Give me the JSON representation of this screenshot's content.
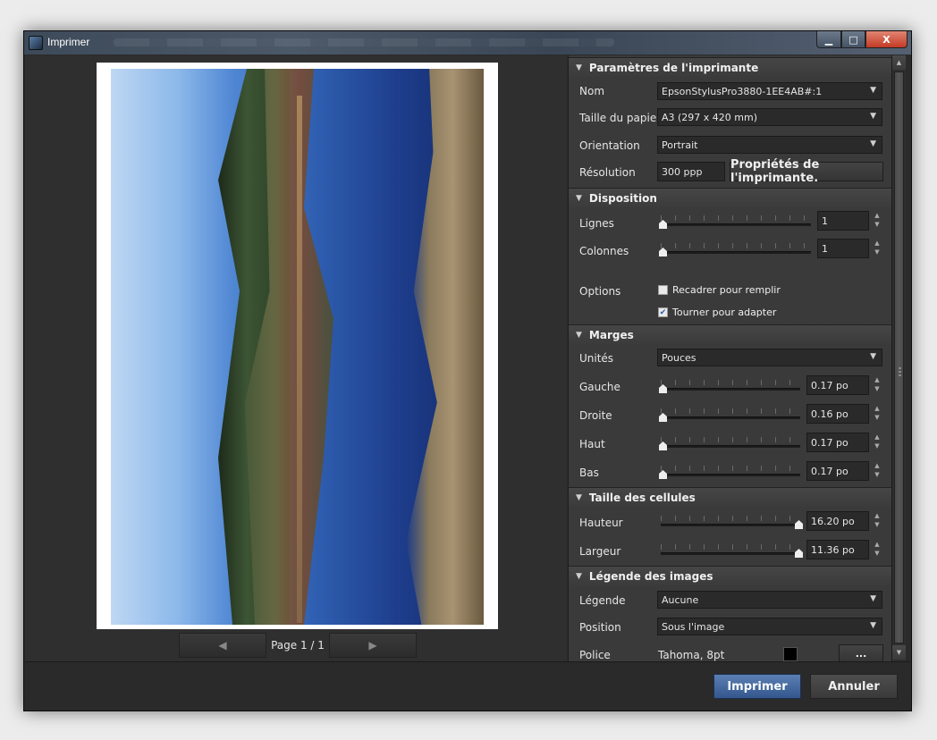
{
  "window": {
    "title": "Imprimer",
    "min": "▁",
    "max": "□",
    "close": "X"
  },
  "preview": {
    "page_label": "Page 1 / 1",
    "prev": "◀",
    "next": "▶"
  },
  "printer": {
    "header": "Paramètres de l'imprimante",
    "name_label": "Nom",
    "name_value": "EpsonStylusPro3880-1EE4AB#:1",
    "paper_label": "Taille du papie",
    "paper_value": "A3 (297 x 420 mm)",
    "orientation_label": "Orientation",
    "orientation_value": "Portrait",
    "resolution_label": "Résolution",
    "resolution_value": "300 ppp",
    "properties_button": "Propriétés de l'imprimante."
  },
  "layout": {
    "header": "Disposition",
    "rows_label": "Lignes",
    "rows_value": "1",
    "cols_label": "Colonnes",
    "cols_value": "1",
    "options_label": "Options",
    "opt_crop": "Recadrer pour remplir",
    "opt_crop_checked": false,
    "opt_rotate": "Tourner pour adapter",
    "opt_rotate_checked": true
  },
  "margins": {
    "header": "Marges",
    "units_label": "Unités",
    "units_value": "Pouces",
    "left_label": "Gauche",
    "left_value": "0.17 po",
    "right_label": "Droite",
    "right_value": "0.16 po",
    "top_label": "Haut",
    "top_value": "0.17 po",
    "bottom_label": "Bas",
    "bottom_value": "0.17 po"
  },
  "cells": {
    "header": "Taille des cellules",
    "height_label": "Hauteur",
    "height_value": "16.20 po",
    "width_label": "Largeur",
    "width_value": "11.36 po"
  },
  "captions": {
    "header": "Légende des images",
    "caption_label": "Légende",
    "caption_value": "Aucune",
    "position_label": "Position",
    "position_value": "Sous l'image",
    "font_label": "Police",
    "font_value": "Tahoma, 8pt",
    "font_color": "#000000",
    "more_button": "..."
  },
  "footer": {
    "print_button": "Imprimer",
    "cancel_button": "Annuler"
  },
  "colors": {
    "accent": "#4a6fa5",
    "panel": "#3a3a3a",
    "window": "#2b2b2b"
  }
}
